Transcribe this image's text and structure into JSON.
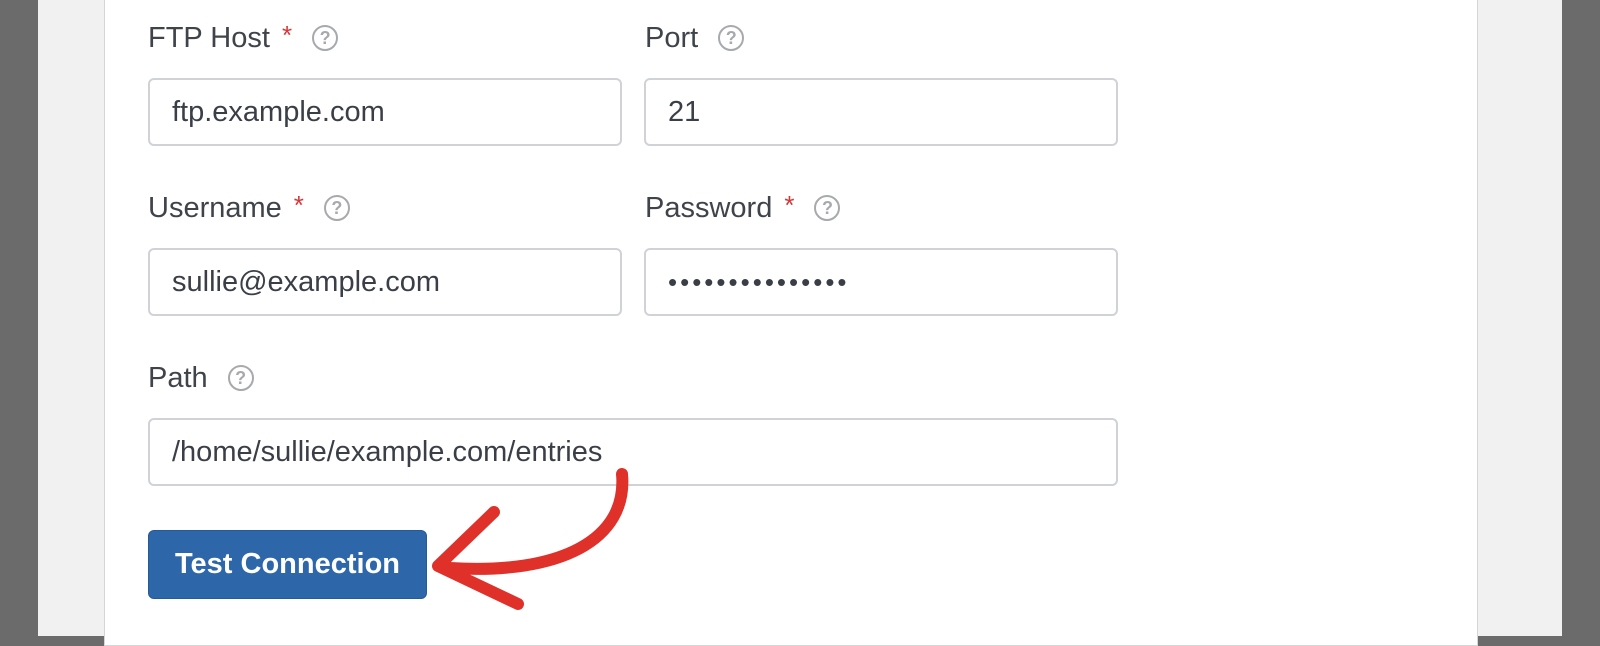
{
  "form": {
    "ftp_host": {
      "label": "FTP Host",
      "required_mark": "*",
      "value": "ftp.example.com"
    },
    "port": {
      "label": "Port",
      "value": "21"
    },
    "username": {
      "label": "Username",
      "required_mark": "*",
      "value": "sullie@example.com"
    },
    "password": {
      "label": "Password",
      "required_mark": "*",
      "value": "•••••••••••••••"
    },
    "path": {
      "label": "Path",
      "value": "/home/sullie/example.com/entries"
    },
    "help_glyph": "?",
    "test_button_label": "Test Connection"
  },
  "annotation": {
    "arrow_color": "#e0302a",
    "icon": "curved-arrow-icon"
  },
  "colors": {
    "accent": "#2d67a9",
    "required": "#d63638"
  }
}
